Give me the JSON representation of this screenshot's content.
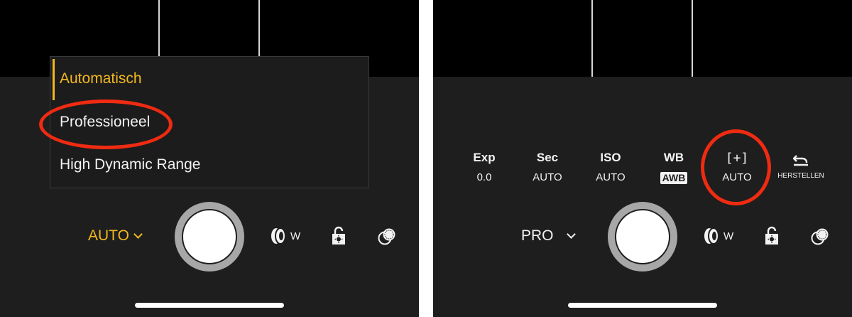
{
  "left_panel": {
    "mode_menu": {
      "items": [
        {
          "label": "Automatisch",
          "selected": true
        },
        {
          "label": "Professioneel",
          "selected": false
        },
        {
          "label": "High Dynamic Range",
          "selected": false
        }
      ]
    },
    "mode_switch_label": "AUTO",
    "lens_label": "W"
  },
  "right_panel": {
    "params": [
      {
        "name": "Exp",
        "value": "0.0"
      },
      {
        "name": "Sec",
        "value": "AUTO"
      },
      {
        "name": "ISO",
        "value": "AUTO"
      },
      {
        "name": "WB",
        "value": "AWB"
      },
      {
        "name": "[+]",
        "value": "AUTO"
      }
    ],
    "reset_label": "HERSTELLEN",
    "mode_switch_label": "PRO",
    "lens_label": "W"
  },
  "colors": {
    "accent_yellow": "#f2b81f",
    "annotation_red": "#ef2b12",
    "background": "#1e1e1e"
  }
}
